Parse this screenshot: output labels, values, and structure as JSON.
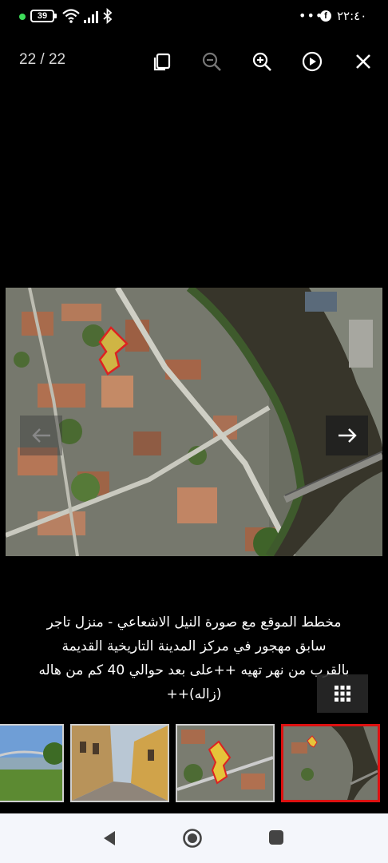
{
  "status_bar": {
    "battery": "39",
    "time": "٢٢:٤٠",
    "more_dots": "•••",
    "fb_letter": "f"
  },
  "viewer": {
    "counter": "22 / 22",
    "caption": "مخطط الموقع مع صورة النيل الاشعاعي - منزل تاجر\nسابق مهجور في مركز المدينة التاريخية القديمة\nبالقرب من نهر تهيه ++على بعد حوالي 40 كم من هاله\n(زاله)++"
  },
  "icons": {
    "toolbar": [
      "copy-icon",
      "zoom-out-icon",
      "zoom-in-icon",
      "play-icon",
      "close-icon"
    ],
    "nav": [
      "back-icon",
      "home-icon",
      "recents-icon"
    ]
  },
  "thumbnails": [
    {
      "label": "river-view"
    },
    {
      "label": "street-view"
    },
    {
      "label": "site-plan"
    },
    {
      "label": "satellite-view",
      "active": true
    }
  ]
}
